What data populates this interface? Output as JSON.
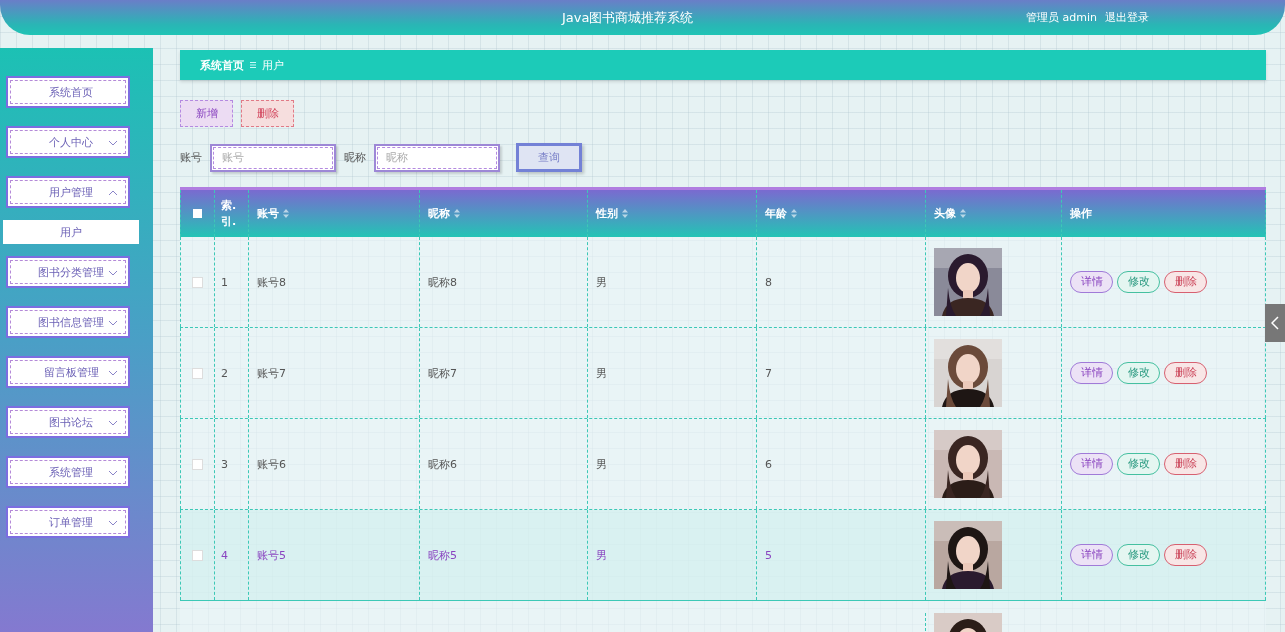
{
  "header": {
    "title": "Java图书商城推荐系统",
    "user": "管理员 admin",
    "logout": "退出登录"
  },
  "sidebar": {
    "items": [
      {
        "label": "系统首页",
        "kind": "link"
      },
      {
        "label": "个人中心",
        "kind": "menu",
        "expanded": false
      },
      {
        "label": "用户管理",
        "kind": "menu",
        "expanded": true,
        "children": [
          {
            "label": "用户",
            "selected": true
          }
        ]
      },
      {
        "label": "图书分类管理",
        "kind": "menu",
        "expanded": false
      },
      {
        "label": "图书信息管理",
        "kind": "menu",
        "expanded": false
      },
      {
        "label": "留言板管理",
        "kind": "menu",
        "expanded": false
      },
      {
        "label": "图书论坛",
        "kind": "menu",
        "expanded": false
      },
      {
        "label": "系统管理",
        "kind": "menu",
        "expanded": false
      },
      {
        "label": "订单管理",
        "kind": "menu",
        "expanded": false
      }
    ]
  },
  "breadcrumb": [
    "系统首页",
    "用户"
  ],
  "actions": [
    {
      "label": "新增",
      "kind": "add"
    },
    {
      "label": "删除",
      "kind": "delete"
    }
  ],
  "search": {
    "fields": [
      {
        "label": "账号",
        "placeholder": "账号"
      },
      {
        "label": "昵称",
        "placeholder": "昵称"
      }
    ],
    "button": "查询"
  },
  "table": {
    "select_all": false,
    "columns": [
      {
        "label": "索. 引.",
        "sortable": false
      },
      {
        "label": "账号",
        "sortable": true
      },
      {
        "label": "昵称",
        "sortable": true
      },
      {
        "label": "性别",
        "sortable": true
      },
      {
        "label": "年龄",
        "sortable": true
      },
      {
        "label": "头像",
        "sortable": true
      },
      {
        "label": "操作",
        "sortable": false
      }
    ],
    "rows": [
      {
        "checked": false,
        "hovered": false,
        "cells": [
          "1",
          "账号8",
          "昵称8",
          "男",
          "8"
        ],
        "avatar": {
          "kind": "picture"
        },
        "actions": [
          {
            "label": "详情",
            "kind": "detail"
          },
          {
            "label": "修改",
            "kind": "edit"
          },
          {
            "label": "删除",
            "kind": "delete"
          }
        ]
      },
      {
        "checked": false,
        "hovered": false,
        "cells": [
          "2",
          "账号7",
          "昵称7",
          "男",
          "7"
        ],
        "avatar": {
          "kind": "picture"
        },
        "actions": [
          {
            "label": "详情",
            "kind": "detail"
          },
          {
            "label": "修改",
            "kind": "edit"
          },
          {
            "label": "删除",
            "kind": "delete"
          }
        ]
      },
      {
        "checked": false,
        "hovered": false,
        "cells": [
          "3",
          "账号6",
          "昵称6",
          "男",
          "6"
        ],
        "avatar": {
          "kind": "picture"
        },
        "actions": [
          {
            "label": "详情",
            "kind": "detail"
          },
          {
            "label": "修改",
            "kind": "edit"
          },
          {
            "label": "删除",
            "kind": "delete"
          }
        ]
      },
      {
        "checked": false,
        "hovered": true,
        "cells": [
          "4",
          "账号5",
          "昵称5",
          "男",
          "5"
        ],
        "avatar": {
          "kind": "picture"
        },
        "actions": [
          {
            "label": "详情",
            "kind": "detail"
          },
          {
            "label": "修改",
            "kind": "edit"
          },
          {
            "label": "删除",
            "kind": "delete"
          }
        ]
      }
    ],
    "partial_rows": [
      {
        "avatar": {
          "kind": "picture"
        }
      }
    ]
  }
}
